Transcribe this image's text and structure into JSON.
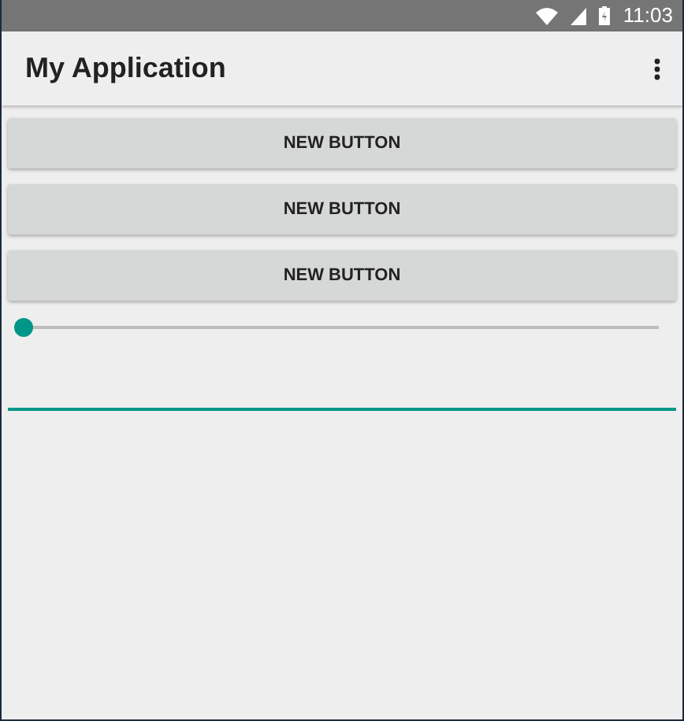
{
  "status_bar": {
    "time": "11:03"
  },
  "app_bar": {
    "title": "My Application"
  },
  "buttons": [
    {
      "label": "NEW BUTTON"
    },
    {
      "label": "NEW BUTTON"
    },
    {
      "label": "NEW BUTTON"
    }
  ],
  "slider": {
    "level": 0
  },
  "text_field": {
    "focused": true
  }
}
